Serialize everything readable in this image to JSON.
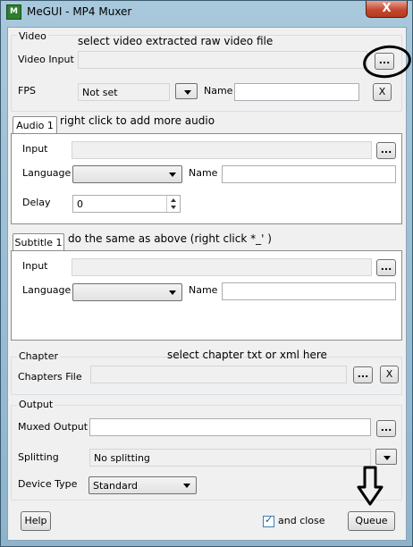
{
  "window": {
    "title": "MeGUI - MP4 Muxer",
    "close_label": "X",
    "app_icon_label": "M"
  },
  "video": {
    "group_label": "Video",
    "input_label": "Video Input",
    "input_value": "",
    "browse_label": "...",
    "fps_label": "FPS",
    "fps_value": "Not set",
    "name_label": "Name",
    "name_value": "",
    "clear_label": "X",
    "annotation": "select video extracted raw video file"
  },
  "audio": {
    "tab_label": "Audio 1",
    "annotation": "right click to add more audio",
    "input_label": "Input",
    "input_value": "",
    "browse_label": "...",
    "language_label": "Language",
    "language_value": "",
    "name_label": "Name",
    "name_value": "",
    "delay_label": "Delay",
    "delay_value": "0"
  },
  "subtitle": {
    "tab_label": "Subtitle 1",
    "annotation": "do the same as above (right click *_' )",
    "input_label": "Input",
    "input_value": "",
    "browse_label": "...",
    "language_label": "Language",
    "language_value": "",
    "name_label": "Name",
    "name_value": ""
  },
  "chapter": {
    "group_label": "Chapter",
    "annotation": "select chapter txt or xml here",
    "file_label": "Chapters File",
    "file_value": "",
    "browse_label": "...",
    "clear_label": "X"
  },
  "output": {
    "group_label": "Output",
    "muxed_label": "Muxed Output",
    "muxed_value": "",
    "browse_label": "...",
    "splitting_label": "Splitting",
    "splitting_value": "No splitting",
    "device_label": "Device Type",
    "device_value": "Standard"
  },
  "footer": {
    "help_label": "Help",
    "and_close_label": "and close",
    "and_close_checked": true,
    "queue_label": "Queue"
  }
}
